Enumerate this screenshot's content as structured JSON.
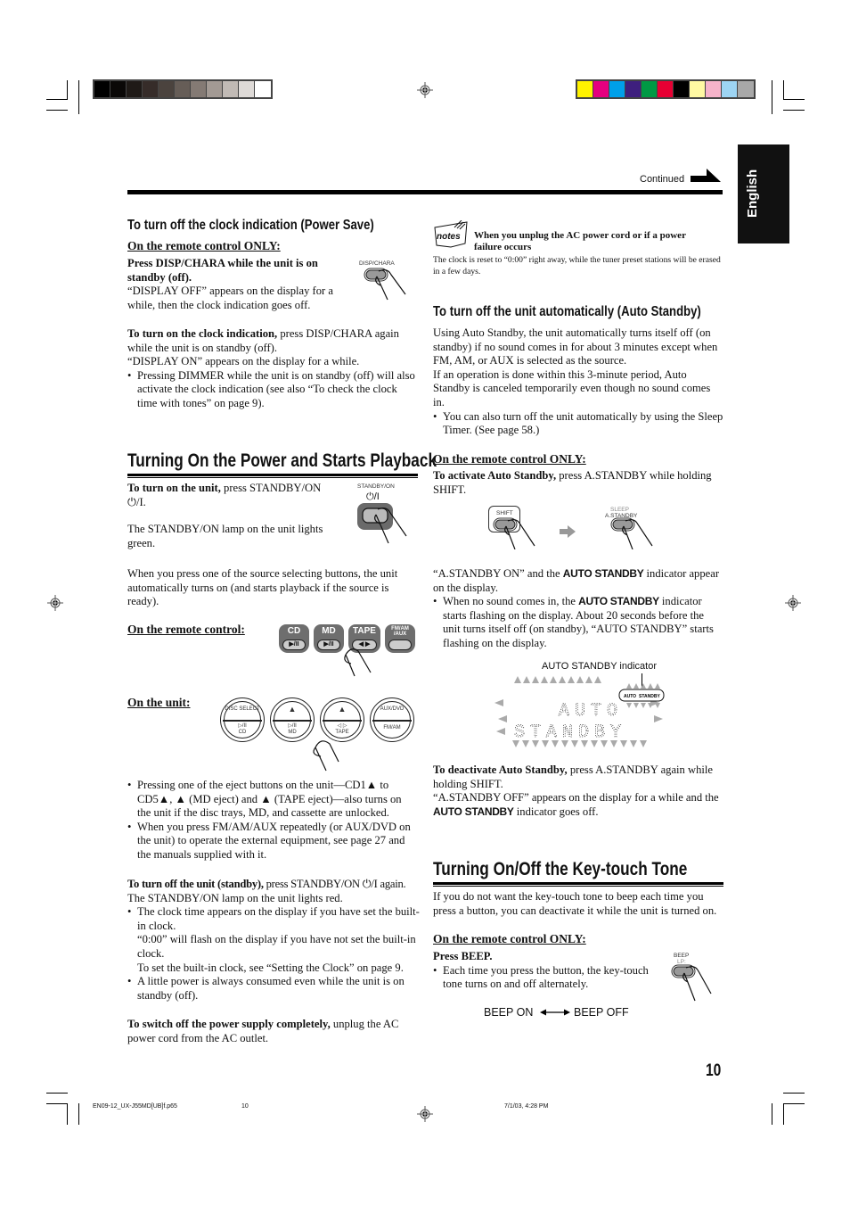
{
  "print_marks": {
    "gray_swatches": [
      "#000000",
      "#0a0807",
      "#1f1a17",
      "#362c29",
      "#4b433e",
      "#665d57",
      "#847a74",
      "#a39a94",
      "#c1bab5",
      "#dedad7",
      "#ffffff"
    ],
    "color_swatches": [
      "#fff200",
      "#e4007f",
      "#00a0e9",
      "#3e1f7e",
      "#009944",
      "#e60033",
      "#000000",
      "#fff9a3",
      "#f6b3ca",
      "#9dd4f3",
      "#a8a8a8"
    ]
  },
  "side_tab": {
    "label": "English"
  },
  "header": {
    "continued_label": "Continued"
  },
  "left": {
    "power_save": {
      "heading": "To turn off the clock indication (Power Save)",
      "remote_only": "On the remote control ONLY:",
      "instruction_bold": "Press DISP/CHARA while the unit is on standby (off).",
      "instruction_result": "“DISPLAY OFF” appears on the display for a while, then the clock indication goes off.",
      "button_label": "DISP/CHARA",
      "turn_on_bold": "To turn on the clock indication,",
      "turn_on_text": " press DISP/CHARA again while the unit is on standby (off).",
      "turn_on_result": "“DISPLAY ON” appears on the display for a while.",
      "bullets": [
        "Pressing DIMMER while the unit is on standby (off) will also activate the clock indication (see also “To check the clock time with tones” on page 9)."
      ]
    },
    "power_on": {
      "heading": "Turning On the Power and Starts Playback",
      "turn_on_bold": "To turn on the unit,",
      "turn_on_text": " press STANDBY/ON ⏻/I.",
      "lamp_text": "The STANDBY/ON lamp on the unit lights green.",
      "standby_label": "STANDBY/ON",
      "standby_symbol": "⏻/I",
      "source_text": "When you press one of the source selecting buttons, the unit automatically turns on (and starts playback if the source is ready).",
      "remote_label": "On the remote control:",
      "remote_buttons": [
        {
          "label": "CD",
          "sub": "▶/II"
        },
        {
          "label": "MD",
          "sub": "▶/II"
        },
        {
          "label": "TAPE",
          "sub": "◀ ▶"
        },
        {
          "label": "FM/AM /AUX",
          "sub": ""
        }
      ],
      "unit_label": "On the unit:",
      "unit_buttons": [
        {
          "top": "DISC SELECT",
          "bottom_sym": "▷/II",
          "bottom": "CD"
        },
        {
          "top": "▲",
          "bottom_sym": "▷/II",
          "bottom": "MD"
        },
        {
          "top": "▲",
          "bottom_sym": "◁ ▷",
          "bottom": "TAPE"
        },
        {
          "top": "AUX/DVD",
          "bottom_sym": "",
          "bottom": "FM/AM"
        }
      ],
      "bullets": [
        "Pressing one of the eject buttons on the unit—CD1▲ to CD5▲, ▲ (MD eject) and ▲ (TAPE eject)—also turns on the unit if the disc trays, MD, and cassette are unlocked.",
        "When you press FM/AM/AUX repeatedly (or AUX/DVD on the unit) to operate the external equipment, see page 27 and the manuals supplied with it."
      ],
      "turn_off_bold": "To turn off the unit (standby),",
      "turn_off_text": " press STANDBY/ON ⏻/I again.",
      "turn_off_lamp": "The STANDBY/ON lamp on the unit lights red.",
      "off_bullets": [
        "The clock time appears on the display if you have set the built-in clock.",
        "A little power is always consumed even while the unit is on standby (off)."
      ],
      "clock_flash": "“0:00” will flash on the display if you have not set the built-in clock.",
      "clock_set": "To set the built-in clock, see “Setting the Clock” on page 9.",
      "switch_off_bold": "To switch off the power supply completely,",
      "switch_off_text": " unplug the AC power cord from the AC outlet."
    }
  },
  "right": {
    "notes": {
      "icon_label": "notes",
      "title": "When you unplug the AC power cord or if a power failure occurs",
      "text": "The clock is reset to “0:00” right away, while the tuner preset stations will be erased in a few days."
    },
    "auto_standby": {
      "heading": "To turn off the unit automatically (Auto Standby)",
      "para1": "Using Auto Standby, the unit automatically turns itself off (on standby) if no sound comes in for about 3 minutes except when FM, AM, or AUX is selected as the source.",
      "para2": "If an operation is done within this 3-minute period, Auto Standby is canceled temporarily even though no sound comes in.",
      "bullets": [
        "You can also turn off the unit automatically by using the Sleep Timer. (See page 58.)"
      ],
      "remote_only": "On the remote control ONLY:",
      "activate_bold": "To activate Auto Standby,",
      "activate_text": " press A.STANDBY while holding SHIFT.",
      "shift_label": "SHIFT",
      "sleep_label": "SLEEP",
      "astandby_label": "A.STANDBY",
      "appear_pre": "“A.STANDBY ON” and the ",
      "indicator_name": "AUTO STANDBY",
      "appear_post": " indicator appear on the display.",
      "flash_pre": "When no sound comes in, the ",
      "flash_post": " indicator starts flashing on the display. About 20 seconds before the unit turns itself off (on standby), “AUTO STANDBY” starts flashing on the display.",
      "indicator_caption": "AUTO STANDBY indicator",
      "display_line1": "AUTO",
      "display_line2": "STANDBY",
      "indicator_left": "AUTO",
      "indicator_right": "STANDBY",
      "deactivate_bold": "To deactivate Auto Standby,",
      "deactivate_text": " press A.STANDBY again while holding SHIFT.",
      "off_pre": "“A.STANDBY OFF” appears on the display for a while and the ",
      "off_post": " indicator goes off."
    },
    "key_tone": {
      "heading": "Turning On/Off the Key-touch Tone",
      "intro": "If you do not want the key-touch tone to beep each time you press a button, you can deactivate it while the unit is turned on.",
      "remote_only": "On the remote control ONLY:",
      "press": "Press BEEP.",
      "bullets": [
        "Each time you press the button, the key-touch tone turns on and off alternately."
      ],
      "beep_label": "BEEP",
      "beep_sub": "LP:",
      "beep_on": "BEEP ON",
      "beep_off": "BEEP OFF"
    }
  },
  "footer": {
    "page_number": "10",
    "file_name": "EN09-12_UX-J55MD[UB]f.p65",
    "slug_page": "10",
    "timestamp": "7/1/03, 4:28 PM"
  }
}
